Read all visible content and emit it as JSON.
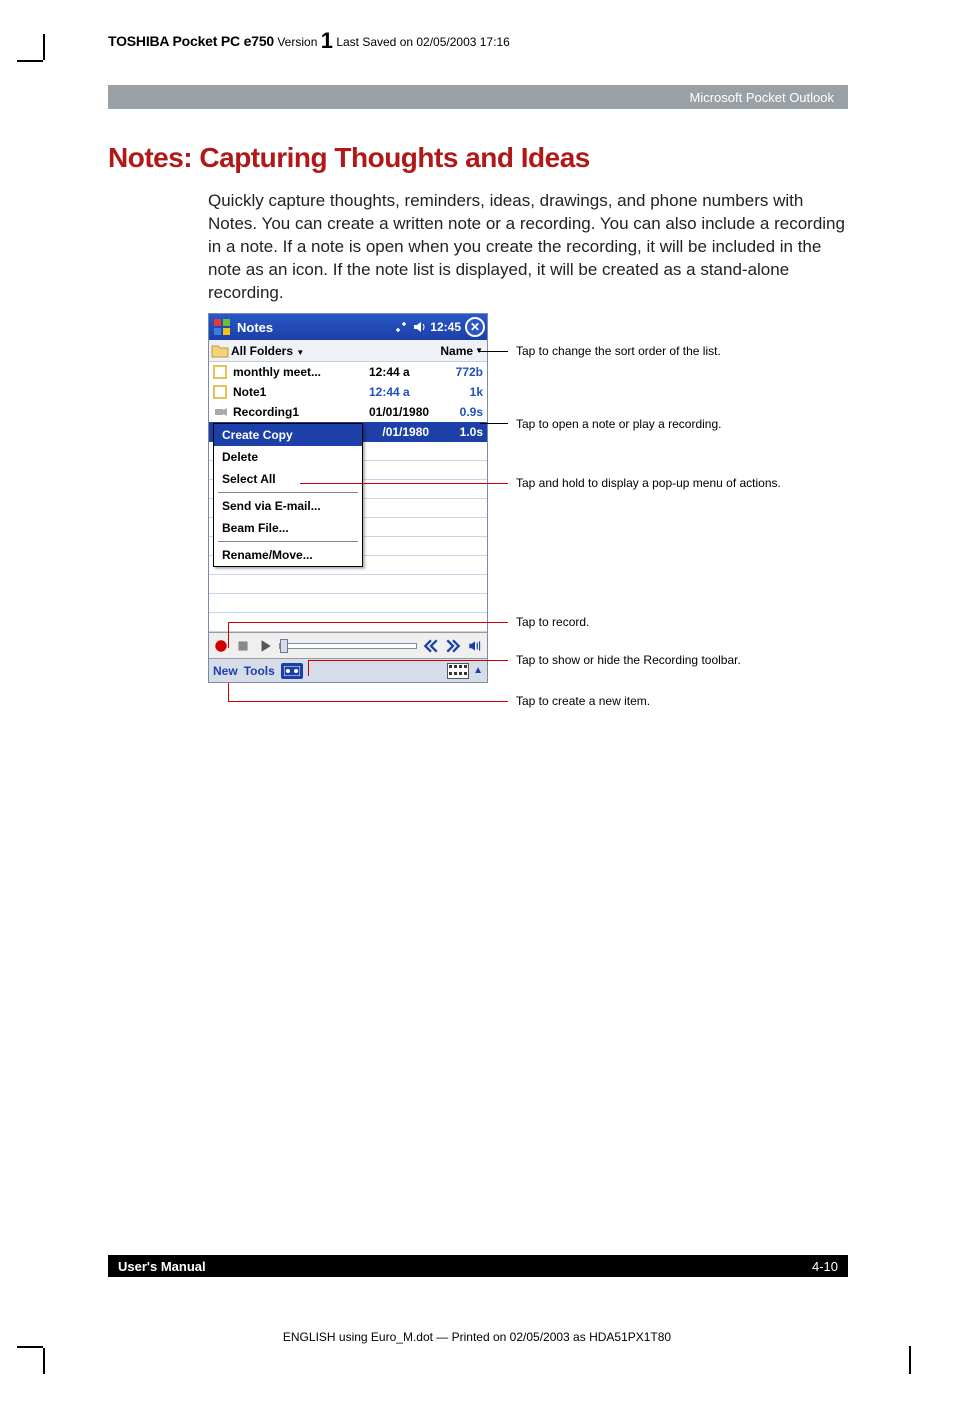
{
  "header": {
    "device": "TOSHIBA Pocket PC e750",
    "version_label": "Version",
    "version_num": "1",
    "saved": "Last Saved on 02/05/2003 17:16"
  },
  "gray_bar": "Microsoft Pocket Outlook",
  "title": "Notes: Capturing Thoughts and Ideas",
  "body": "Quickly capture thoughts, reminders, ideas, drawings, and phone numbers with Notes. You can create a written note or a recording. You can also include a recording in a note. If a note is open when you create the recording, it will be included in the note as an icon. If the note list is displayed, it will be created as a stand-alone recording.",
  "pocket": {
    "app_title": "Notes",
    "time": "12:45",
    "folder": "All Folders",
    "sort": "Name",
    "rows": [
      {
        "name": "monthly meet...",
        "time": "12:44 a",
        "size": "772b"
      },
      {
        "name": "Note1",
        "time": "12:44 a",
        "size": "1k"
      },
      {
        "name": "Recording1",
        "time": "01/01/1980",
        "size": "0.9s"
      },
      {
        "name": "",
        "time": "/01/1980",
        "size": "1.0s"
      }
    ],
    "context_menu": [
      "Create Copy",
      "Delete",
      "Select All",
      "Send via E-mail...",
      "Beam File...",
      "Rename/Move..."
    ],
    "bottom": {
      "new": "New",
      "tools": "Tools"
    }
  },
  "callouts": {
    "sort": "Tap to change the sort order of the list.",
    "open": "Tap to open a note or play a recording.",
    "popup": "Tap and hold to display a pop-up menu of actions.",
    "record": "Tap to record.",
    "toolbar": "Tap to show or hide the Recording toolbar.",
    "new": "Tap to create a new item."
  },
  "footer": {
    "left": "User's Manual",
    "right": "4-10"
  },
  "print_line": "ENGLISH using Euro_M.dot — Printed on 02/05/2003 as HDA51PX1T80"
}
